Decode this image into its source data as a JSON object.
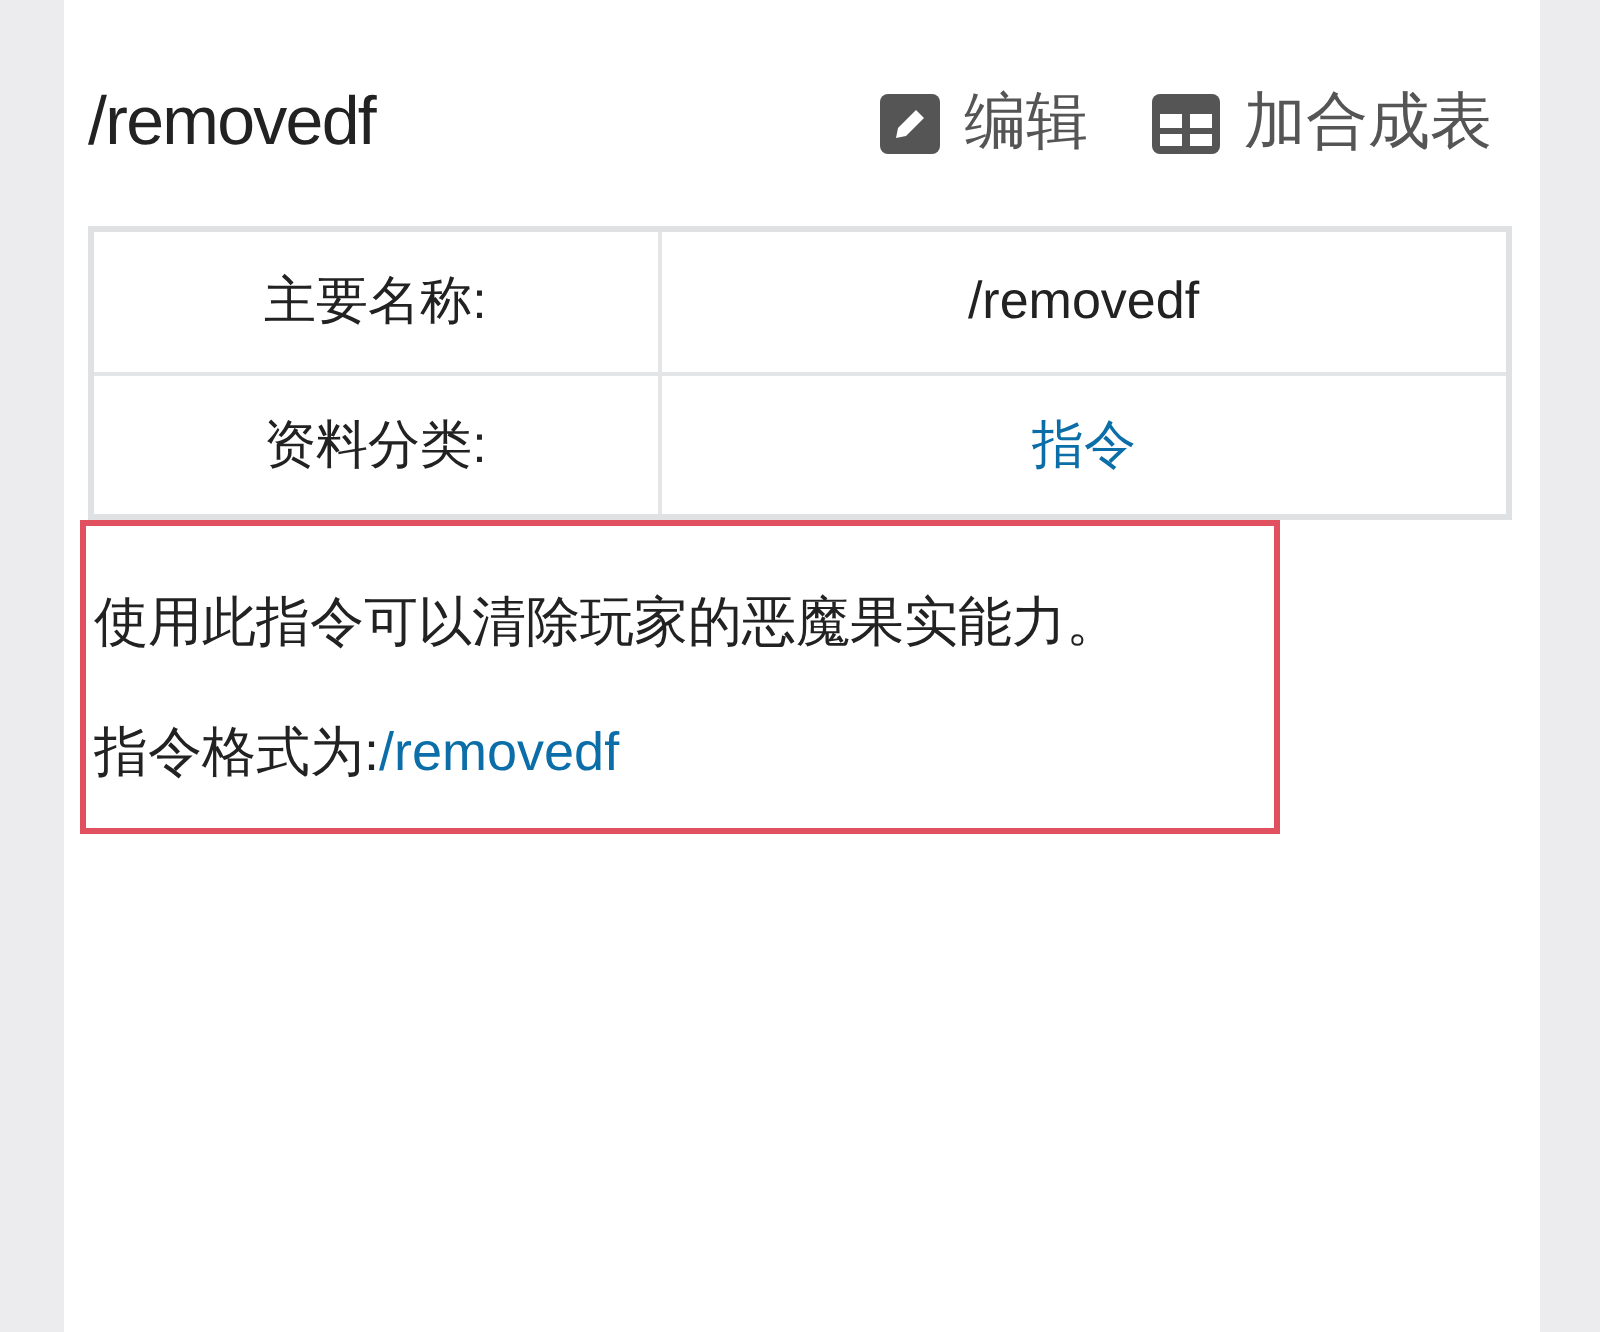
{
  "page_title": "/removedf",
  "actions": [
    {
      "kind": "edit",
      "label": "编辑"
    },
    {
      "kind": "table",
      "label": "加合成表"
    }
  ],
  "info_table": [
    {
      "label": "主要名称:",
      "value": "/removedf",
      "link": false
    },
    {
      "label": "资料分类:",
      "value": "指令",
      "link": true
    }
  ],
  "highlight": {
    "description": "使用此指令可以清除玩家的恶魔果实能力。",
    "format_label": "指令格式为:",
    "format_value": "/removedf"
  }
}
